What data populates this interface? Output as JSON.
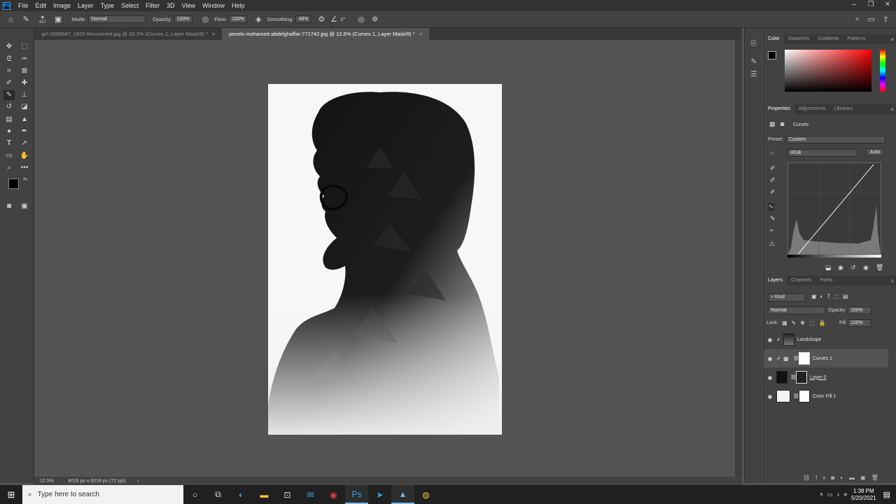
{
  "menu": {
    "items": [
      "File",
      "Edit",
      "Image",
      "Layer",
      "Type",
      "Select",
      "Filter",
      "3D",
      "View",
      "Window",
      "Help"
    ]
  },
  "options": {
    "brush_size": "417",
    "mode_label": "Mode:",
    "mode_value": "Normal",
    "opacity_label": "Opacity:",
    "opacity_value": "100%",
    "flow_label": "Flow:",
    "flow_value": "100%",
    "smoothing_label": "Smoothing:",
    "smoothing_value": "48%",
    "angle_value": "0°"
  },
  "tabs": [
    {
      "label": "girl-2696947_1920-Recovered.jpg @ 33.3% (Curves 1, Layer Mask/8) *",
      "active": false
    },
    {
      "label": "pexels-mohamed-abdelghaffar-771742.jpg @ 12.5% (Curves 1, Layer Mask/8) *",
      "active": true
    }
  ],
  "status": {
    "zoom": "12.5%",
    "doc_info": "4016 px x 6016 px (72 ppi)"
  },
  "color_panel": {
    "tabs": [
      "Color",
      "Swatches",
      "Gradients",
      "Patterns"
    ],
    "active": "Color"
  },
  "properties_panel": {
    "tabs": [
      "Properties",
      "Adjustments",
      "Libraries"
    ],
    "active": "Properties",
    "adjustment_name": "Curves",
    "preset_label": "Preset:",
    "preset_value": "Custom",
    "channel_value": "RGB",
    "auto_label": "Auto"
  },
  "layers_panel": {
    "tabs": [
      "Layers",
      "Channels",
      "Paths"
    ],
    "active": "Layers",
    "filter_kind": "Kind",
    "blend_mode": "Normal",
    "opacity_label": "Opacity:",
    "opacity_value": "100%",
    "lock_label": "Lock:",
    "fill_label": "Fill:",
    "fill_value": "100%",
    "layers": [
      {
        "name": "Landskape",
        "selected": false
      },
      {
        "name": "Curves 1",
        "selected": true
      },
      {
        "name": "Layer 0",
        "selected": false
      },
      {
        "name": "Color Fill 1",
        "selected": false
      }
    ]
  },
  "taskbar": {
    "search_placeholder": "Type here to search",
    "time": "1:38 PM",
    "date": "5/20/2021"
  },
  "colors": {
    "foreground": "#000000",
    "background": "#ffffff",
    "accent": "#31a8ff"
  }
}
